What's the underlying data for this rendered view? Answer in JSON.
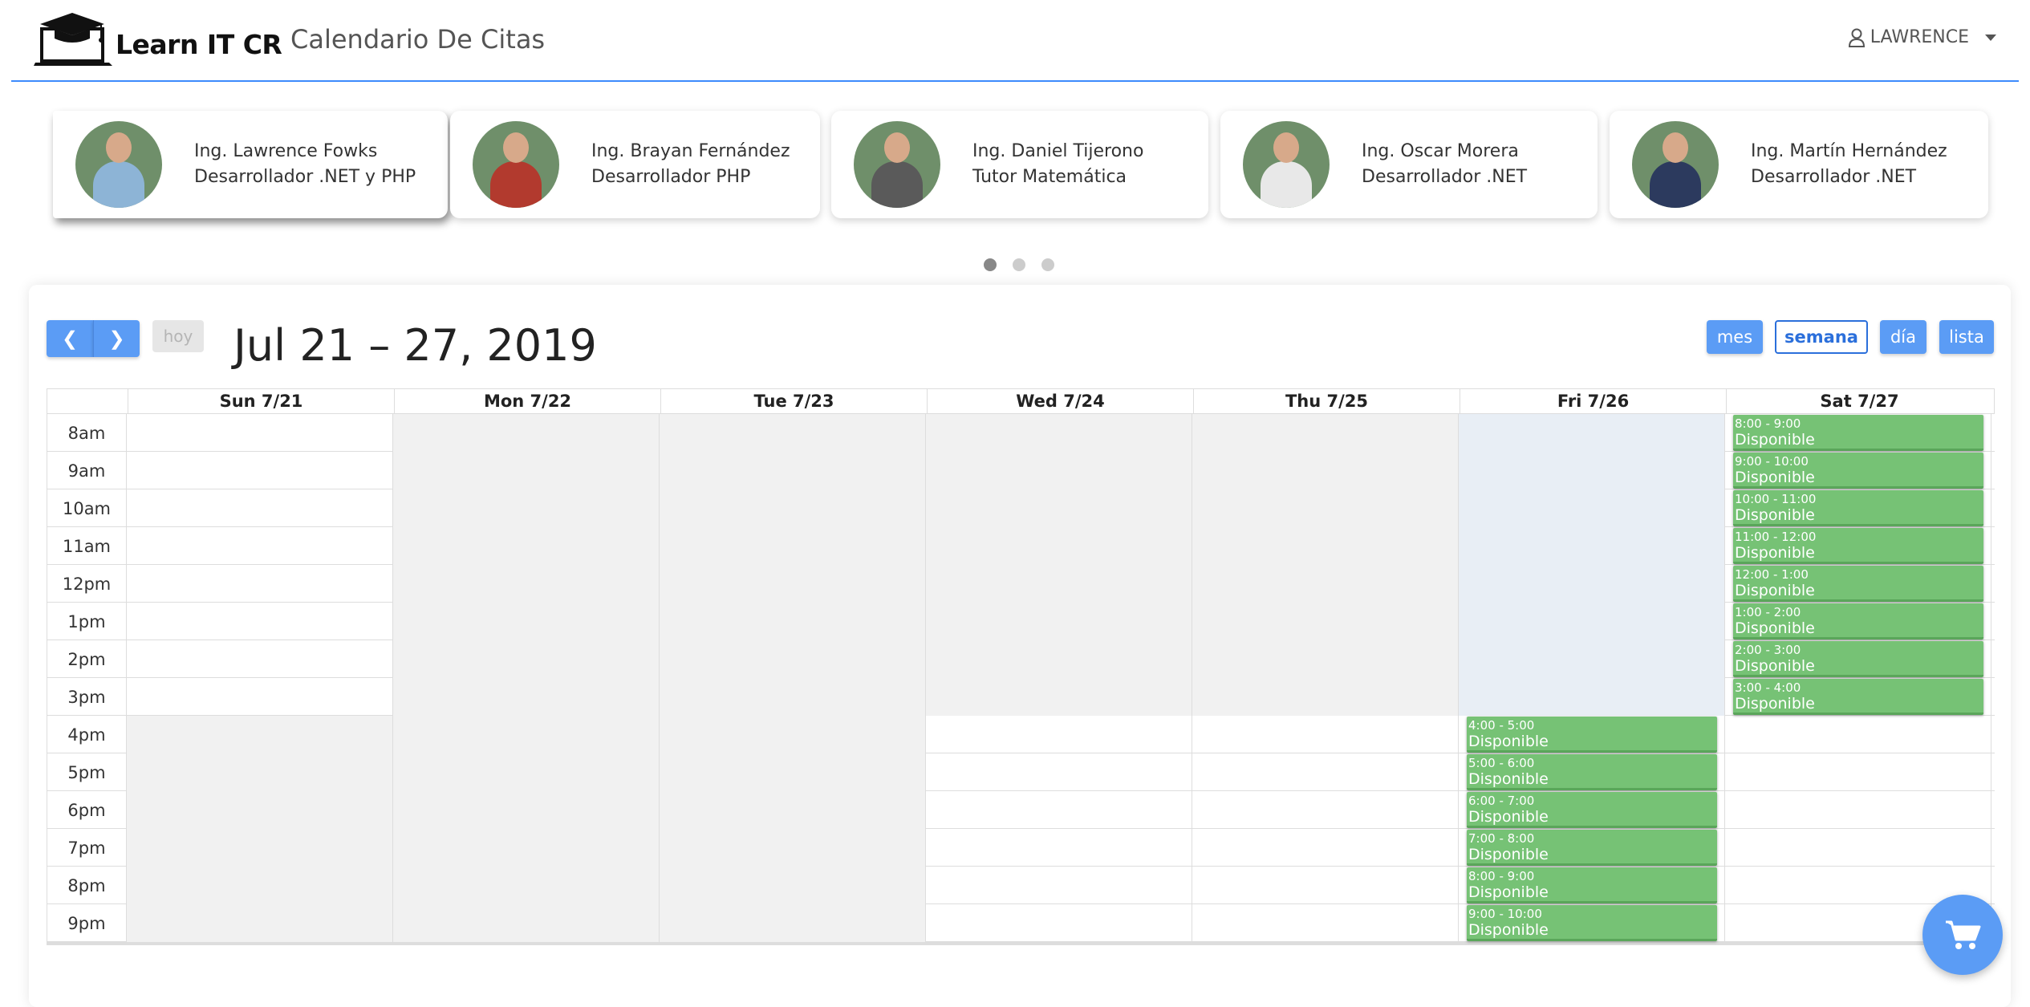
{
  "app": {
    "brand": "Learn IT CR",
    "title": "Calendario De Citas",
    "user": "LAWRENCE"
  },
  "tutors": [
    {
      "name": "Ing. Lawrence Fowks",
      "role": "Desarrollador .NET y PHP",
      "shirt": "#8db4d6"
    },
    {
      "name": "Ing. Brayan Fernández",
      "role": "Desarrollador PHP",
      "shirt": "#b23a2e"
    },
    {
      "name": "Ing. Daniel Tijerono",
      "role": "Tutor Matemática",
      "shirt": "#5a5a5a"
    },
    {
      "name": "Ing. Oscar Morera",
      "role": "Desarrollador .NET",
      "shirt": "#e8e8e8"
    },
    {
      "name": "Ing. Martín Hernández",
      "role": "Desarrollador .NET",
      "shirt": "#2c3a5e"
    }
  ],
  "carousel": {
    "pages": 3,
    "active": 0
  },
  "calendar": {
    "range_title": "Jul 21 – 27, 2019",
    "today_label": "hoy",
    "views": [
      "mes",
      "semana",
      "día",
      "lista"
    ],
    "active_view": "semana",
    "days": [
      "Sun 7/21",
      "Mon 7/22",
      "Tue 7/23",
      "Wed 7/24",
      "Thu 7/25",
      "Fri 7/26",
      "Sat 7/27"
    ],
    "times": [
      "8am",
      "9am",
      "10am",
      "11am",
      "12pm",
      "1pm",
      "2pm",
      "3pm",
      "4pm",
      "5pm",
      "6pm",
      "7pm",
      "8pm",
      "9pm"
    ],
    "today_index": 5,
    "events": [
      {
        "day": 6,
        "slot": 0,
        "time": "8:00 - 9:00",
        "title": "Disponible"
      },
      {
        "day": 6,
        "slot": 1,
        "time": "9:00 - 10:00",
        "title": "Disponible"
      },
      {
        "day": 6,
        "slot": 2,
        "time": "10:00 - 11:00",
        "title": "Disponible"
      },
      {
        "day": 6,
        "slot": 3,
        "time": "11:00 - 12:00",
        "title": "Disponible"
      },
      {
        "day": 6,
        "slot": 4,
        "time": "12:00 - 1:00",
        "title": "Disponible"
      },
      {
        "day": 6,
        "slot": 5,
        "time": "1:00 - 2:00",
        "title": "Disponible"
      },
      {
        "day": 6,
        "slot": 6,
        "time": "2:00 - 3:00",
        "title": "Disponible"
      },
      {
        "day": 6,
        "slot": 7,
        "time": "3:00 - 4:00",
        "title": "Disponible"
      },
      {
        "day": 5,
        "slot": 8,
        "time": "4:00 - 5:00",
        "title": "Disponible"
      },
      {
        "day": 5,
        "slot": 9,
        "time": "5:00 - 6:00",
        "title": "Disponible"
      },
      {
        "day": 5,
        "slot": 10,
        "time": "6:00 - 7:00",
        "title": "Disponible"
      },
      {
        "day": 5,
        "slot": 11,
        "time": "7:00 - 8:00",
        "title": "Disponible"
      },
      {
        "day": 5,
        "slot": 12,
        "time": "8:00 - 9:00",
        "title": "Disponible"
      },
      {
        "day": 5,
        "slot": 13,
        "time": "9:00 - 10:00",
        "title": "Disponible"
      }
    ]
  },
  "colors": {
    "primary": "#5b9cf5",
    "event": "#76c275",
    "closed": "#f1f1f1",
    "today": "#e8eef5"
  },
  "icons": {
    "cart": "shopping-cart-icon",
    "user": "user-icon",
    "logo": "graduation-laptop-icon"
  }
}
